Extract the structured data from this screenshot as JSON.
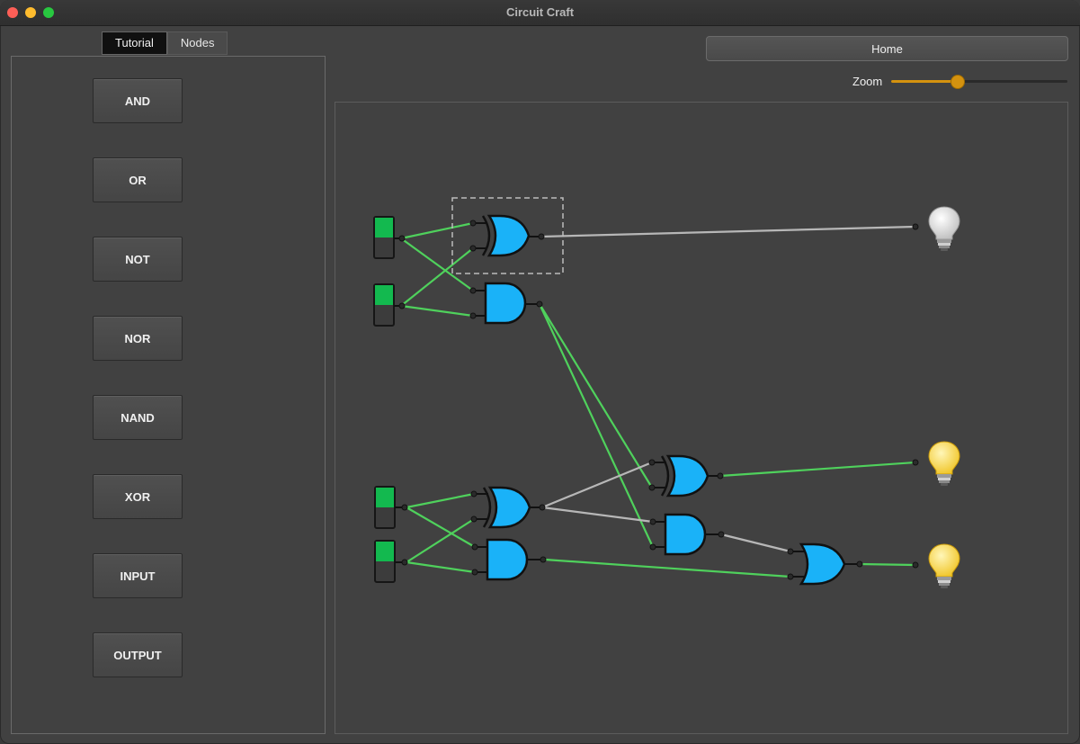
{
  "window": {
    "title": "Circuit Craft"
  },
  "tabs": [
    {
      "label": "Tutorial",
      "active": true
    },
    {
      "label": "Nodes",
      "active": false
    }
  ],
  "nodes": [
    {
      "label": "AND"
    },
    {
      "label": "OR"
    },
    {
      "label": "NOT"
    },
    {
      "label": "NOR"
    },
    {
      "label": "NAND"
    },
    {
      "label": "XOR"
    },
    {
      "label": "INPUT"
    },
    {
      "label": "OUTPUT"
    }
  ],
  "home": {
    "label": "Home"
  },
  "zoom": {
    "label": "Zoom",
    "value_fraction": 0.37
  },
  "colors": {
    "gate_fill": "#1ab2f8",
    "wire_on": "#4fd15c",
    "wire_off": "#b7b7b7",
    "switch_on": "#13b94f",
    "accent": "#d4920f",
    "bulb_on": "#ffd84a",
    "bulb_off": "#e8e8e8"
  },
  "circuit": {
    "inputs": [
      {
        "state": "on"
      },
      {
        "state": "on"
      },
      {
        "state": "on"
      },
      {
        "state": "on"
      }
    ],
    "gates": [
      "xor",
      "and",
      "xor",
      "and",
      "xor",
      "and",
      "or"
    ],
    "outputs": [
      {
        "state": "off"
      },
      {
        "state": "on"
      },
      {
        "state": "on"
      }
    ]
  }
}
